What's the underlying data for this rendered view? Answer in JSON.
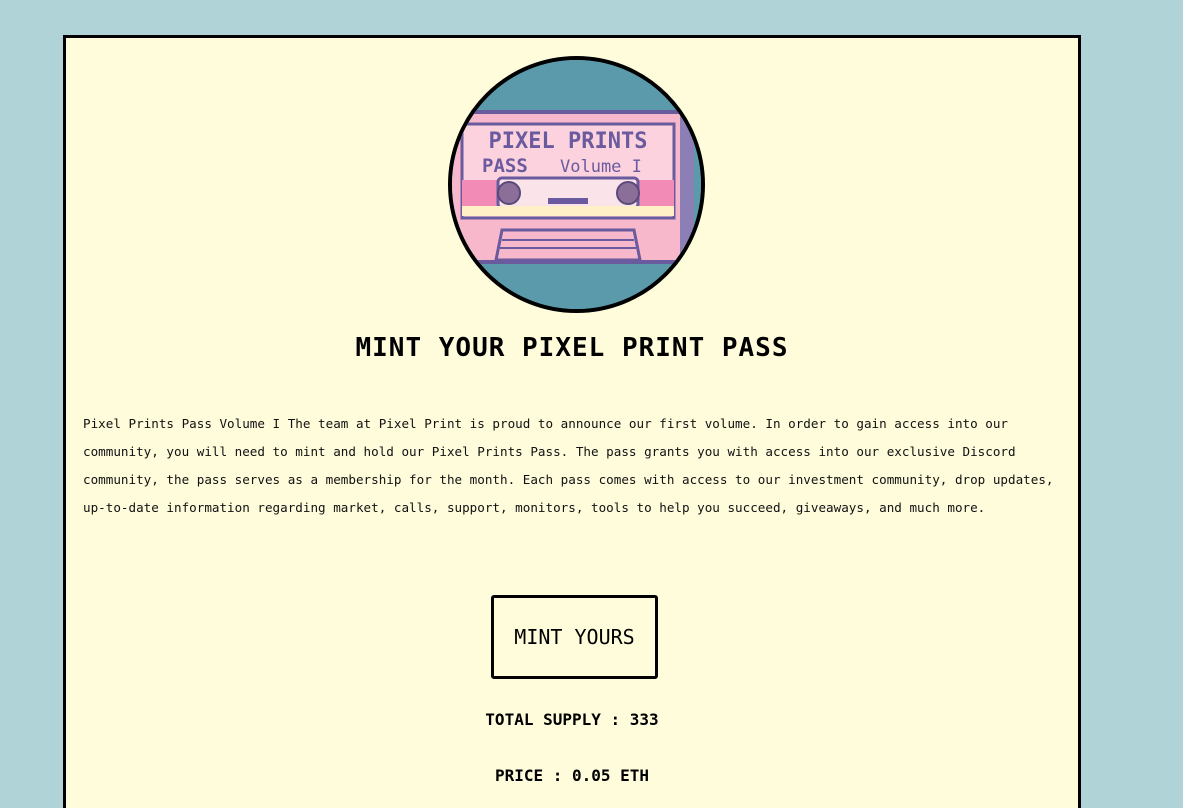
{
  "hero": {
    "title": "MINT YOUR PIXEL PRINT PASS",
    "image_text": {
      "line1": "PIXEL PRINTS",
      "line2_bold": "PASS",
      "line2_rest": "Volume I"
    }
  },
  "description": "Pixel Prints Pass Volume I The team at Pixel Print is proud to announce our first volume. In order to gain access into our community, you will need to mint and hold our Pixel Prints Pass. The pass grants you with access into our exclusive Discord community, the pass serves as a membership for the month. Each pass comes with access to our investment community, drop updates, up-to-date information regarding market, calls, support, monitors, tools to help you succeed, giveaways, and much more.",
  "mint_button_label": "MINT YOURS",
  "stats": {
    "supply": "TOTAL SUPPLY : 333",
    "price": "PRICE : 0.05 ETH"
  },
  "colors": {
    "page_background": "#afd3d6",
    "card_background": "#fffcdc",
    "border": "#000000",
    "cassette_pink": "#f7b8cc",
    "cassette_purple": "#6a5a9e",
    "avatar_background": "#5b9aab"
  }
}
